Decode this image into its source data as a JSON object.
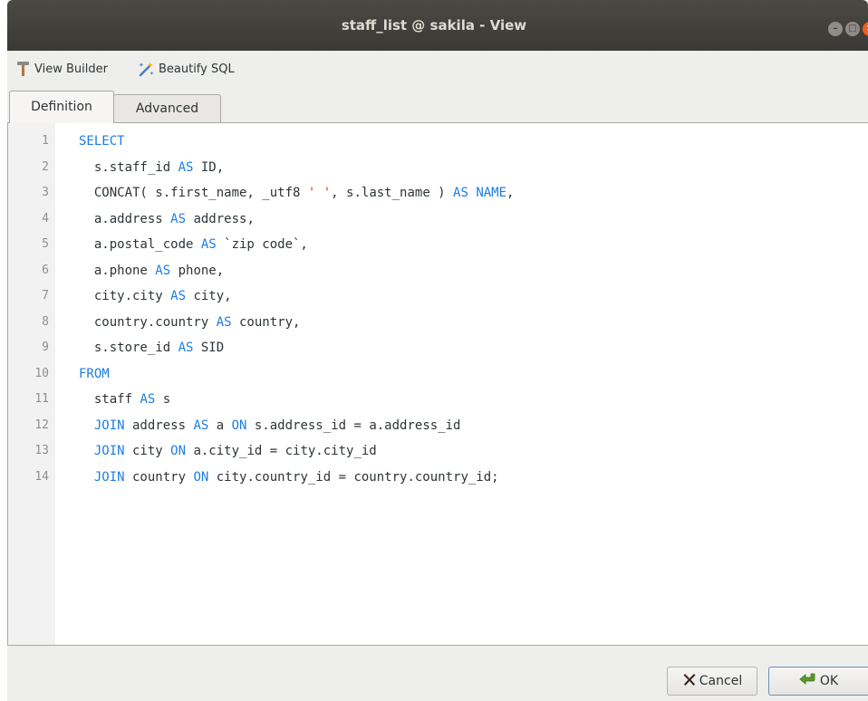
{
  "window": {
    "title": "staff_list @ sakila - View"
  },
  "toolbar": {
    "view_builder_label": "View Builder",
    "beautify_label": "Beautify SQL"
  },
  "tabs": [
    {
      "label": "Definition",
      "active": true
    },
    {
      "label": "Advanced",
      "active": false
    }
  ],
  "editor": {
    "lines": [
      {
        "num": "1",
        "parts": [
          [
            "kw",
            "SELECT"
          ]
        ]
      },
      {
        "num": "2",
        "parts": [
          [
            "t",
            "  s.staff_id "
          ],
          [
            "kw",
            "AS"
          ],
          [
            "t",
            " ID,"
          ]
        ]
      },
      {
        "num": "3",
        "parts": [
          [
            "t",
            "  CONCAT( s.first_name, _utf8 "
          ],
          [
            "str",
            "' '"
          ],
          [
            "t",
            ", s.last_name ) "
          ],
          [
            "kw",
            "AS"
          ],
          [
            "t",
            " "
          ],
          [
            "kw",
            "NAME"
          ],
          [
            "t",
            ","
          ]
        ]
      },
      {
        "num": "4",
        "parts": [
          [
            "t",
            "  a.address "
          ],
          [
            "kw",
            "AS"
          ],
          [
            "t",
            " address,"
          ]
        ]
      },
      {
        "num": "5",
        "parts": [
          [
            "t",
            "  a.postal_code "
          ],
          [
            "kw",
            "AS"
          ],
          [
            "t",
            " `zip code`,"
          ]
        ]
      },
      {
        "num": "6",
        "parts": [
          [
            "t",
            "  a.phone "
          ],
          [
            "kw",
            "AS"
          ],
          [
            "t",
            " phone,"
          ]
        ]
      },
      {
        "num": "7",
        "parts": [
          [
            "t",
            "  city.city "
          ],
          [
            "kw",
            "AS"
          ],
          [
            "t",
            " city,"
          ]
        ]
      },
      {
        "num": "8",
        "parts": [
          [
            "t",
            "  country.country "
          ],
          [
            "kw",
            "AS"
          ],
          [
            "t",
            " country,"
          ]
        ]
      },
      {
        "num": "9",
        "parts": [
          [
            "t",
            "  s.store_id "
          ],
          [
            "kw",
            "AS"
          ],
          [
            "t",
            " SID"
          ]
        ]
      },
      {
        "num": "10",
        "parts": [
          [
            "kw",
            "FROM"
          ]
        ]
      },
      {
        "num": "11",
        "parts": [
          [
            "t",
            "  staff "
          ],
          [
            "kw",
            "AS"
          ],
          [
            "t",
            " s"
          ]
        ]
      },
      {
        "num": "12",
        "parts": [
          [
            "t",
            "  "
          ],
          [
            "kw",
            "JOIN"
          ],
          [
            "t",
            " address "
          ],
          [
            "kw",
            "AS"
          ],
          [
            "t",
            " a "
          ],
          [
            "kw",
            "ON"
          ],
          [
            "t",
            " s.address_id = a.address_id"
          ]
        ]
      },
      {
        "num": "13",
        "parts": [
          [
            "t",
            "  "
          ],
          [
            "kw",
            "JOIN"
          ],
          [
            "t",
            " city "
          ],
          [
            "kw",
            "ON"
          ],
          [
            "t",
            " a.city_id = city.city_id"
          ]
        ]
      },
      {
        "num": "14",
        "parts": [
          [
            "t",
            "  "
          ],
          [
            "kw",
            "JOIN"
          ],
          [
            "t",
            " country "
          ],
          [
            "kw",
            "ON"
          ],
          [
            "t",
            " city.country_id = country.country_id;"
          ]
        ]
      }
    ]
  },
  "footer": {
    "cancel_label": "Cancel",
    "ok_label": "OK"
  },
  "colors": {
    "keyword": "#1c7ee0",
    "string": "#e4342c",
    "titlebar": "#3c3b37",
    "close_button": "#f15d22"
  },
  "icons": {
    "view_builder": "hammer-icon",
    "beautify": "magic-wand-icon",
    "cancel": "x-icon",
    "ok": "green-arrow-icon"
  }
}
